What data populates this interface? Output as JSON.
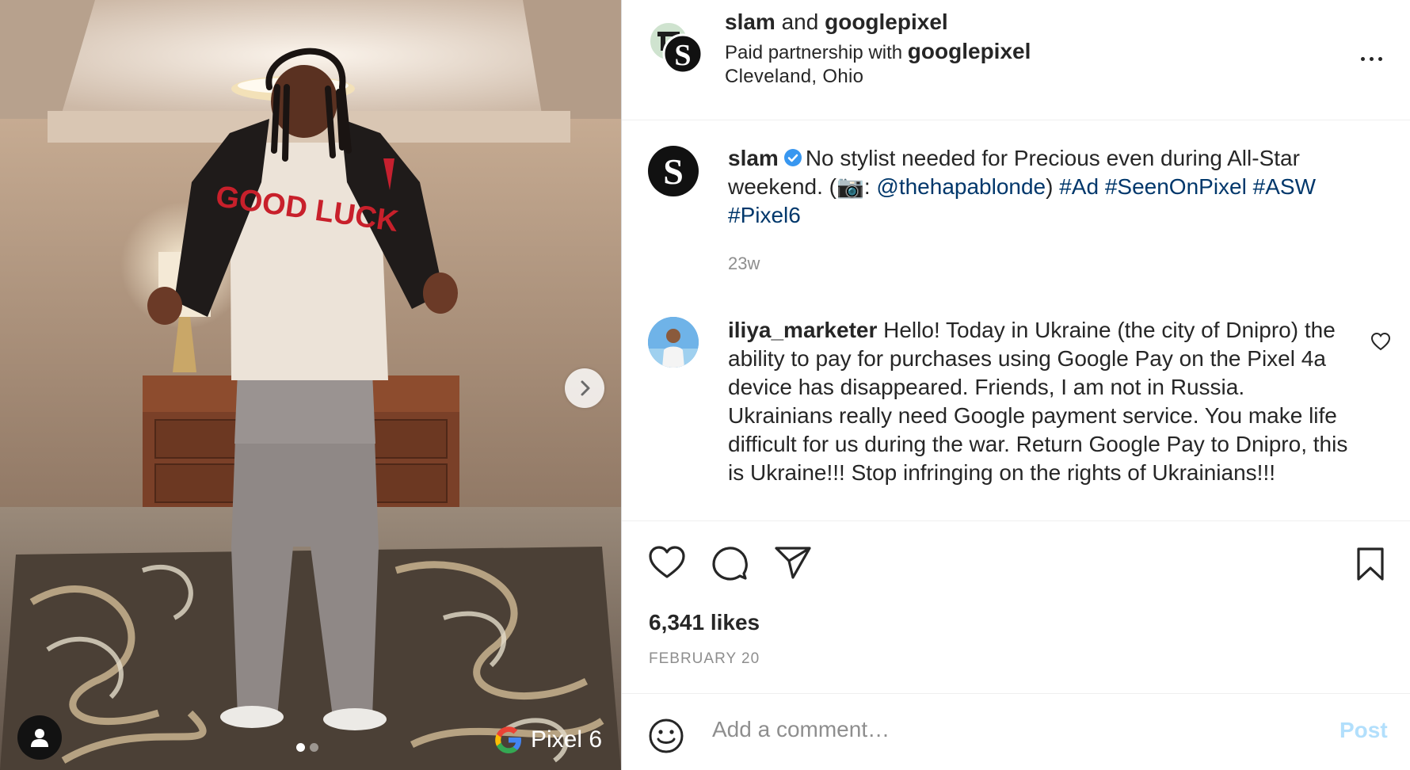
{
  "header": {
    "account": "slam",
    "and": "and",
    "collaborator": "googlepixel",
    "partner_prefix": "Paid partnership with",
    "partner_name": "googlepixel",
    "location": "Cleveland, Ohio",
    "more_icon": "more-horizontal-icon"
  },
  "media": {
    "shirt_text": "GOOD LUCK",
    "brand_label": "Pixel 6",
    "carousel_total": 2,
    "carousel_index": 1,
    "icons": [
      "chevron-right-icon",
      "user-tag-icon",
      "google-g-icon"
    ]
  },
  "caption": {
    "username": "slam",
    "verified": true,
    "text_1": "No stylist needed for Precious even during All-Star weekend. (",
    "camera_emoji": "📷",
    "text_2": ": ",
    "mention": "@thehapablonde",
    "text_3": ") ",
    "hashtags": [
      "#Ad",
      "#SeenOnPixel",
      "#ASW",
      "#Pixel6"
    ],
    "time": "23w"
  },
  "comment": {
    "username": "iliya_marketer",
    "text": "Hello! Today in Ukraine (the city of Dnipro) the ability to pay for purchases using Google Pay on the Pixel 4a device has disappeared. Friends, I am not in Russia. Ukrainians really need Google payment service. You make life difficult for us during the war. Return Google Pay to Dnipro, this is Ukraine!!! Stop infringing on the rights of Ukrainians!!!"
  },
  "actions": {
    "likes": "6,341 likes",
    "date": "FEBRUARY 20",
    "icons": [
      "heart-icon",
      "comment-icon",
      "share-icon",
      "bookmark-icon"
    ]
  },
  "add_comment": {
    "placeholder": "Add a comment…",
    "post_label": "Post"
  },
  "colors": {
    "link": "#00376b",
    "verified": "#3897f0",
    "post_disabled": "#b2dffc",
    "muted": "#8e8e8e"
  }
}
